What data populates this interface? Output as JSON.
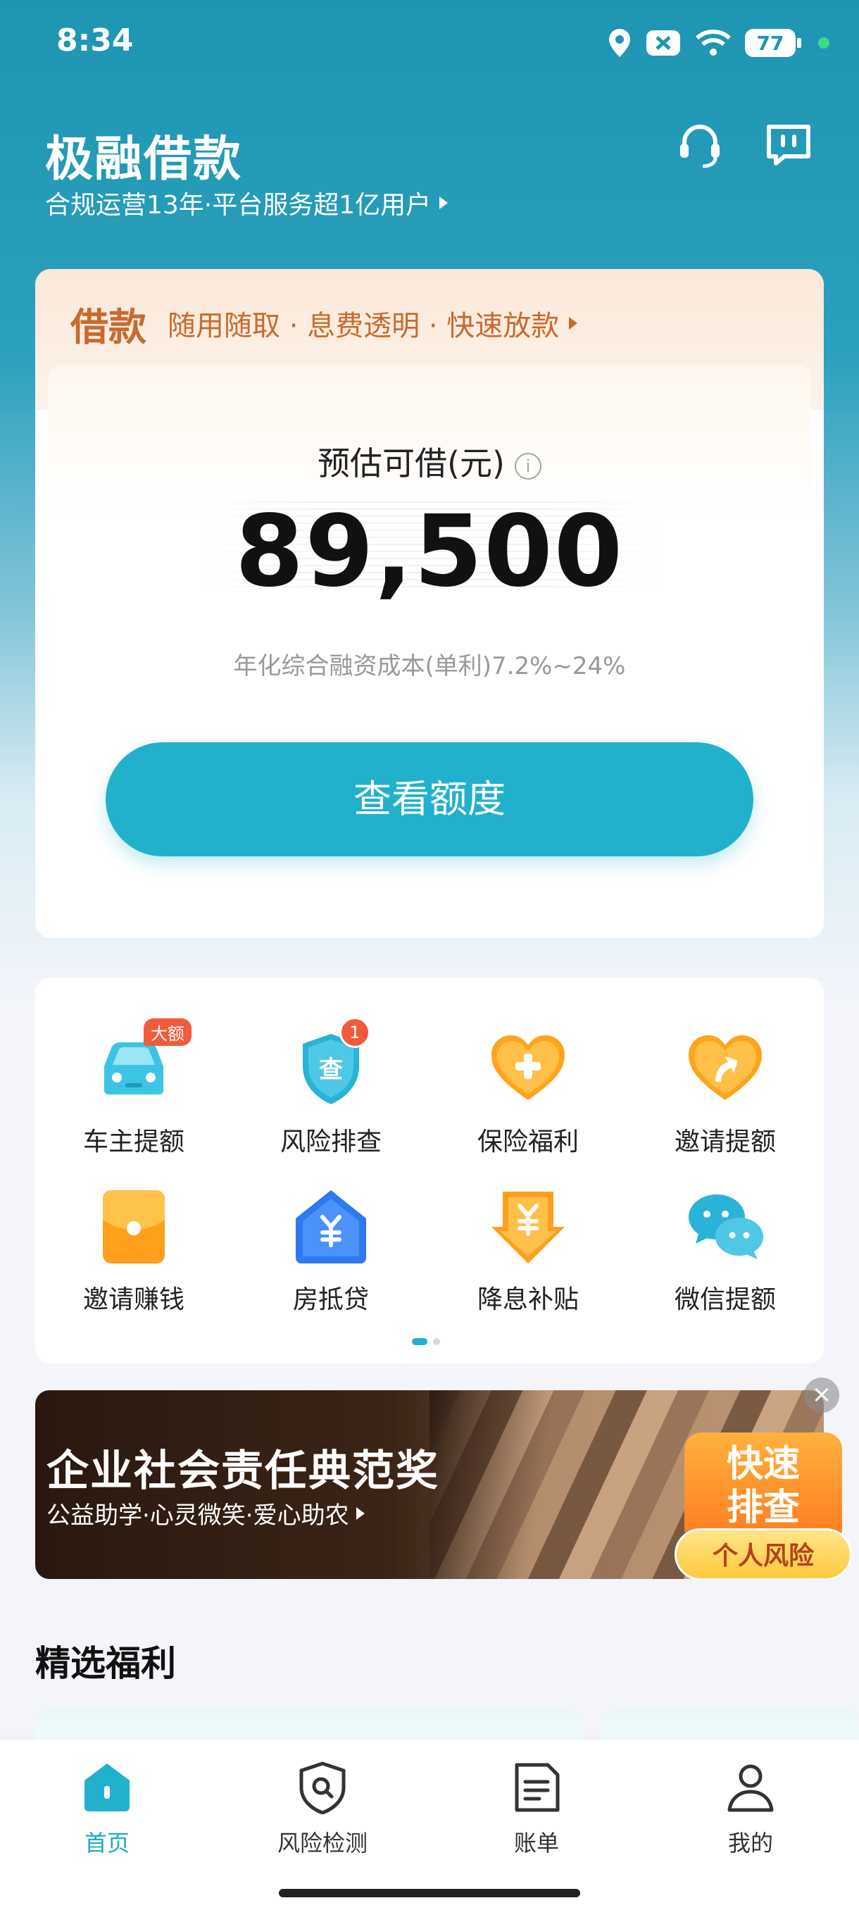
{
  "status_bar": {
    "time": "8:34",
    "battery": "77"
  },
  "header": {
    "title": "极融借款",
    "subtitle": "合规运营13年·平台服务超1亿用户"
  },
  "loan_card": {
    "tag": "借款",
    "slogan": "随用随取 · 息费透明 · 快速放款",
    "amount_label": "预估可借(元)",
    "amount": "89,500",
    "rate_text": "年化综合融资成本(单利)7.2%~24%",
    "cta": "查看额度"
  },
  "shortcuts": [
    {
      "label": "车主提额",
      "badge": "大额"
    },
    {
      "label": "风险排查",
      "badge": "1"
    },
    {
      "label": "保险福利"
    },
    {
      "label": "邀请提额"
    },
    {
      "label": "邀请赚钱"
    },
    {
      "label": "房抵贷"
    },
    {
      "label": "降息补贴"
    },
    {
      "label": "微信提额"
    }
  ],
  "banner": {
    "title": "企业社会责任典范奖",
    "subtitle": "公益助学·心灵微笑·爱心助农",
    "float_top": "快速排查",
    "float_bottom": "个人风险"
  },
  "section": {
    "title": "精选福利"
  },
  "tabs": [
    {
      "label": "首页",
      "icon": "home-icon"
    },
    {
      "label": "风险检测",
      "icon": "shield-search-icon"
    },
    {
      "label": "账单",
      "icon": "bill-icon"
    },
    {
      "label": "我的",
      "icon": "user-icon"
    }
  ],
  "colors": {
    "accent": "#21B1CC",
    "brand_orange": "#C96A2E",
    "badge_red": "#F35A3C"
  }
}
